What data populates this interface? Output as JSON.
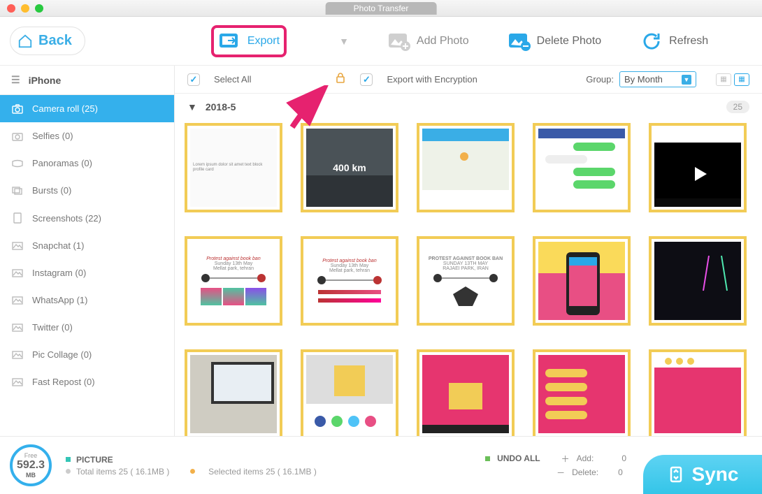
{
  "window": {
    "title": "Photo Transfer"
  },
  "toolbar": {
    "back": "Back",
    "export": "Export",
    "add_photo": "Add Photo",
    "delete_photo": "Delete Photo",
    "refresh": "Refresh"
  },
  "sidebar": {
    "device": "iPhone",
    "items": [
      {
        "label": "Camera roll (25)",
        "icon": "camera"
      },
      {
        "label": "Selfies (0)",
        "icon": "selfie"
      },
      {
        "label": "Panoramas (0)",
        "icon": "panorama"
      },
      {
        "label": "Bursts (0)",
        "icon": "burst"
      },
      {
        "label": "Screenshots (22)",
        "icon": "screenshot"
      },
      {
        "label": "Snapchat (1)",
        "icon": "album"
      },
      {
        "label": "Instagram (0)",
        "icon": "album"
      },
      {
        "label": "WhatsApp (1)",
        "icon": "album"
      },
      {
        "label": "Twitter (0)",
        "icon": "album"
      },
      {
        "label": "Pic Collage (0)",
        "icon": "album"
      },
      {
        "label": "Fast Repost (0)",
        "icon": "album"
      }
    ]
  },
  "controls": {
    "select_all": "Select All",
    "export_encryption": "Export with Encryption",
    "group_label": "Group:",
    "group_value": "By Month"
  },
  "section": {
    "title": "2018-5",
    "count": "25"
  },
  "thumbs": {
    "km": "400 km"
  },
  "footer": {
    "free_label": "Free",
    "free_value": "592.3",
    "free_unit": "MB",
    "picture_label": "PICTURE",
    "total_line": "Total items 25 ( 16.1MB )",
    "selected_line": "Selected items 25 ( 16.1MB )",
    "undo_all": "UNDO ALL",
    "add_label": "Add:",
    "add_value": "0",
    "delete_label": "Delete:",
    "delete_value": "0",
    "sync": "Sync"
  }
}
